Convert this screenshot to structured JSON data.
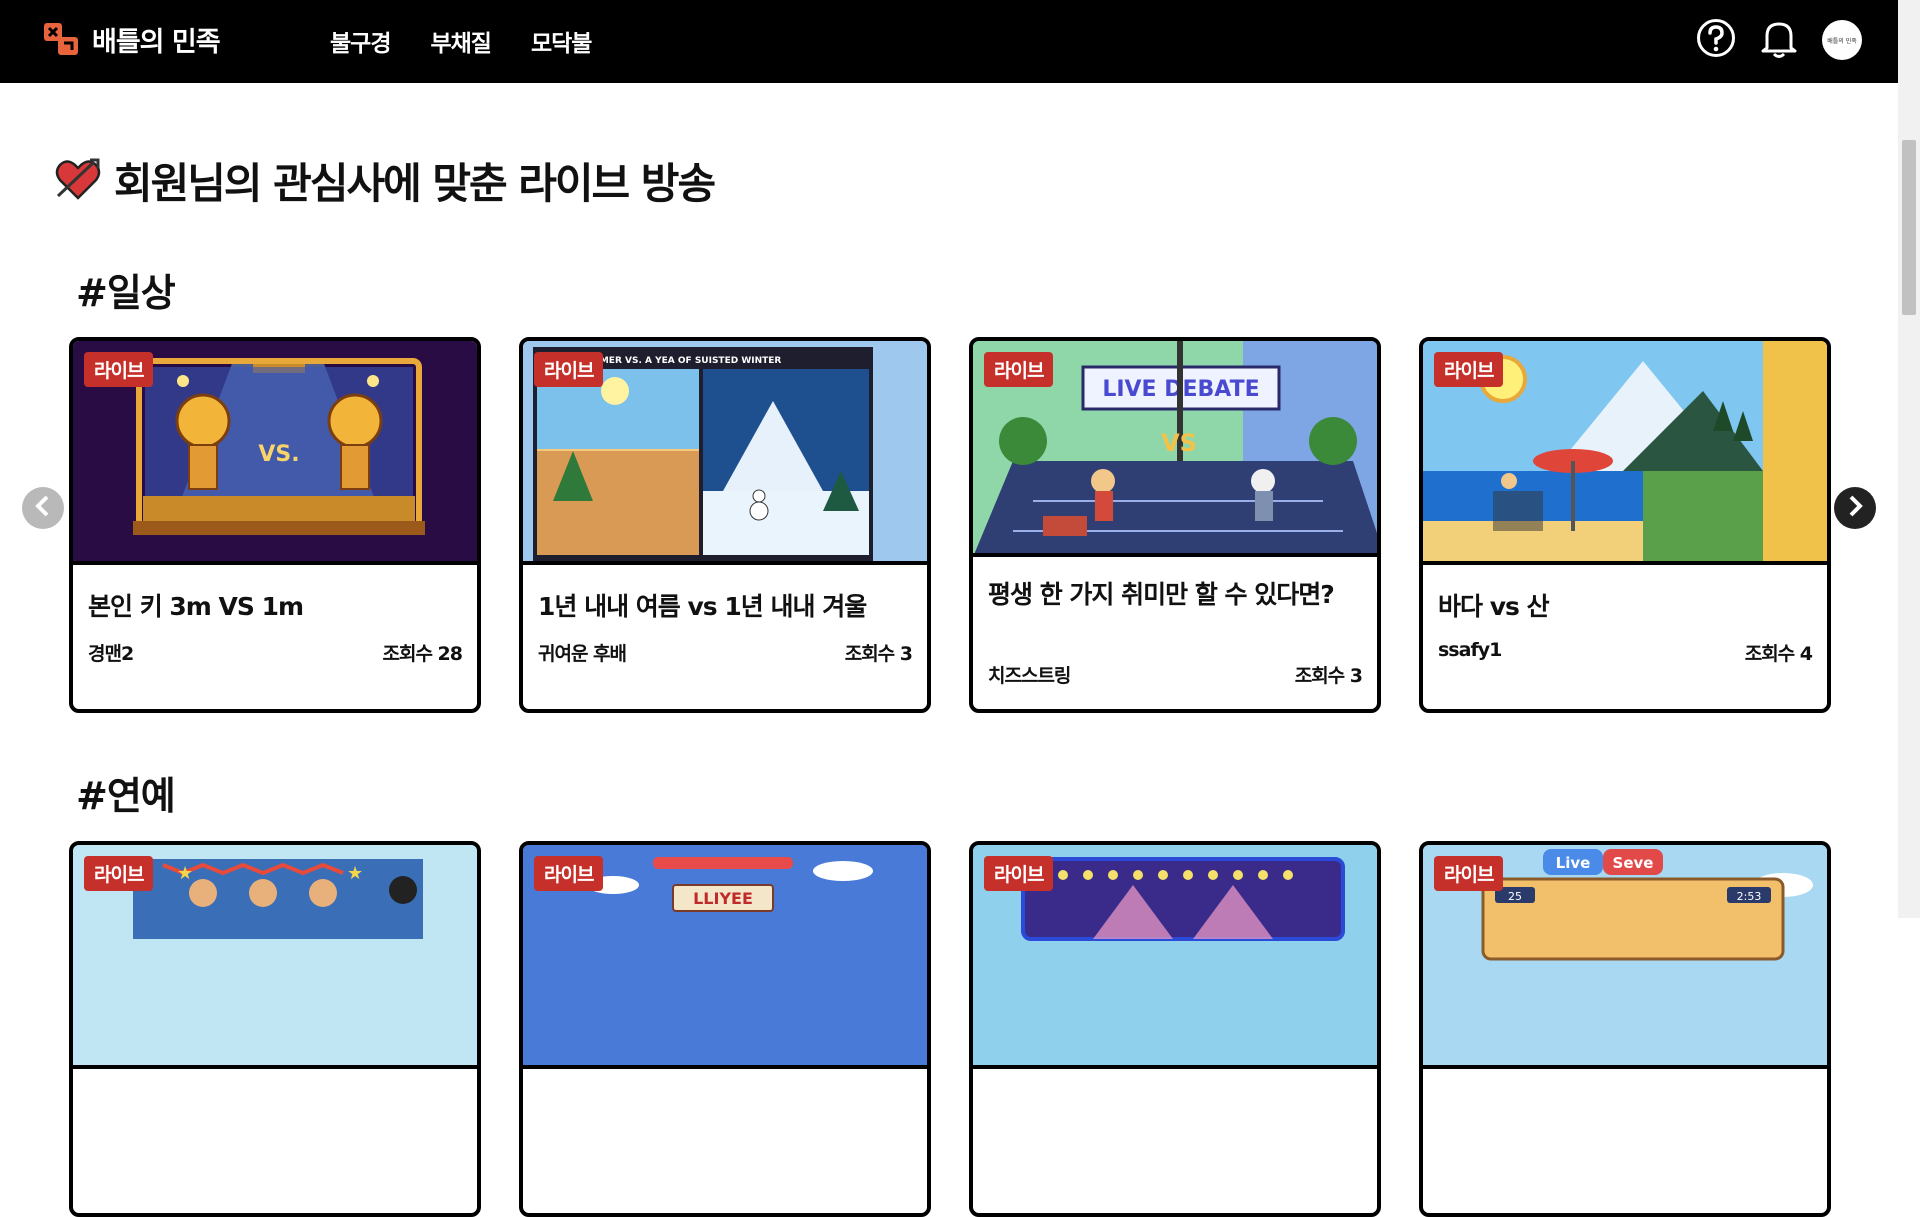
{
  "header": {
    "logo_text": "배틀의 민족",
    "nav": [
      "불구경",
      "부채질",
      "모닥불"
    ],
    "avatar_text": "배틀의 민족"
  },
  "main": {
    "page_title": "회원님의 관심사에 맞춘 라이브 방송",
    "sections": [
      {
        "title": "#일상",
        "cards": [
          {
            "badge": "라이브",
            "title": "본인 키 3m VS 1m",
            "author": "경맨2",
            "views": "조회수 28"
          },
          {
            "badge": "라이브",
            "title": "1년 내내 여름 vs 1년 내내 겨울",
            "author": "귀여운 후배",
            "views": "조회수 3"
          },
          {
            "badge": "라이브",
            "title": "평생 한 가지 취미만 할 수 있다면?",
            "author": "치즈스트링",
            "views": "조회수 3"
          },
          {
            "badge": "라이브",
            "title": "바다 vs 산",
            "author": "ssafy1",
            "views": "조회수 4"
          }
        ]
      },
      {
        "title": "#연예",
        "cards": [
          {
            "badge": "라이브"
          },
          {
            "badge": "라이브"
          },
          {
            "badge": "라이브"
          },
          {
            "badge": "라이브"
          }
        ]
      }
    ]
  },
  "image_text": {
    "card2_banner": "EAR OF SUMMER VS. A YEA OF SUISTED WINTER",
    "card3_banner": "LIVE DEBATE",
    "card3_vs": "VS",
    "card1_vs": "VS.",
    "card6_banner": "LLIYEE",
    "card8_tab_live": "Live",
    "card8_tab_seve": "Seve",
    "card8_score_left": "25",
    "card8_score_right": "2:53"
  },
  "colors": {
    "header_bg": "#000000",
    "badge_bg": "#c6302a",
    "card_border": "#000000"
  }
}
